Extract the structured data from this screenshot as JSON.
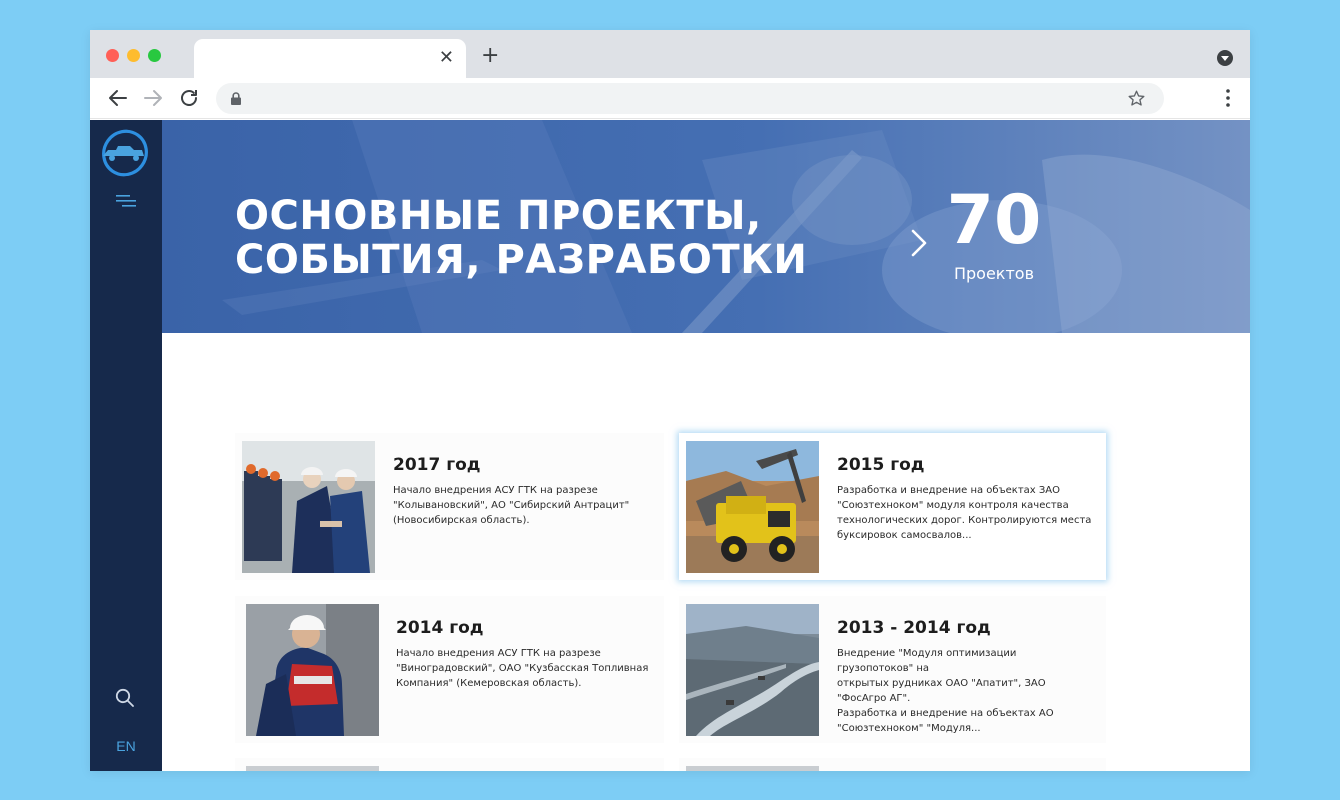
{
  "browser": {
    "tab_close_icon": "close-icon",
    "new_tab_label": "+"
  },
  "sidebar": {
    "lang": "EN"
  },
  "hero": {
    "title_line1": "ОСНОВНЫЕ ПРОЕКТЫ,",
    "title_line2": "СОБЫТИЯ, РАЗРАБОТКИ",
    "count": "70",
    "count_label": "Проектов",
    "bg_color": "#3e68ad"
  },
  "projects": [
    {
      "year": "2017 год",
      "text": "Начало внедрения АСУ ГТК на разрезе\n\"Колывановский\", АО \"Сибирский Антрацит\"\n(Новосибирская область)."
    },
    {
      "year": "2015 год",
      "text": "Разработка и внедрение на объектах ЗАО\n\"Союзтехноком\" модуля контроля качества\nтехнологических дорог. Контролируются места\nбуксировок самосвалов..."
    },
    {
      "year": "2014 год",
      "text": " Начало внедрения АСУ ГТК на разрезе\n\"Виноградовский\", ОАО \"Кузбасская Топливная\nКомпания\" (Кемеровская область)."
    },
    {
      "year": "2013 - 2014 год",
      "text": "Внедрение \"Модуля оптимизации грузопотоков\" на\nоткрытых рудниках ОАО \"Апатит\", ЗАО \"ФосАгро АГ\".\nРазработка и внедрение на объектах АО\n\"Союзтехноком\" \"Модуля..."
    }
  ],
  "colors": {
    "sidebar": "#16294b",
    "accent": "#4aa3df",
    "page_background": "#7dcdf5"
  }
}
